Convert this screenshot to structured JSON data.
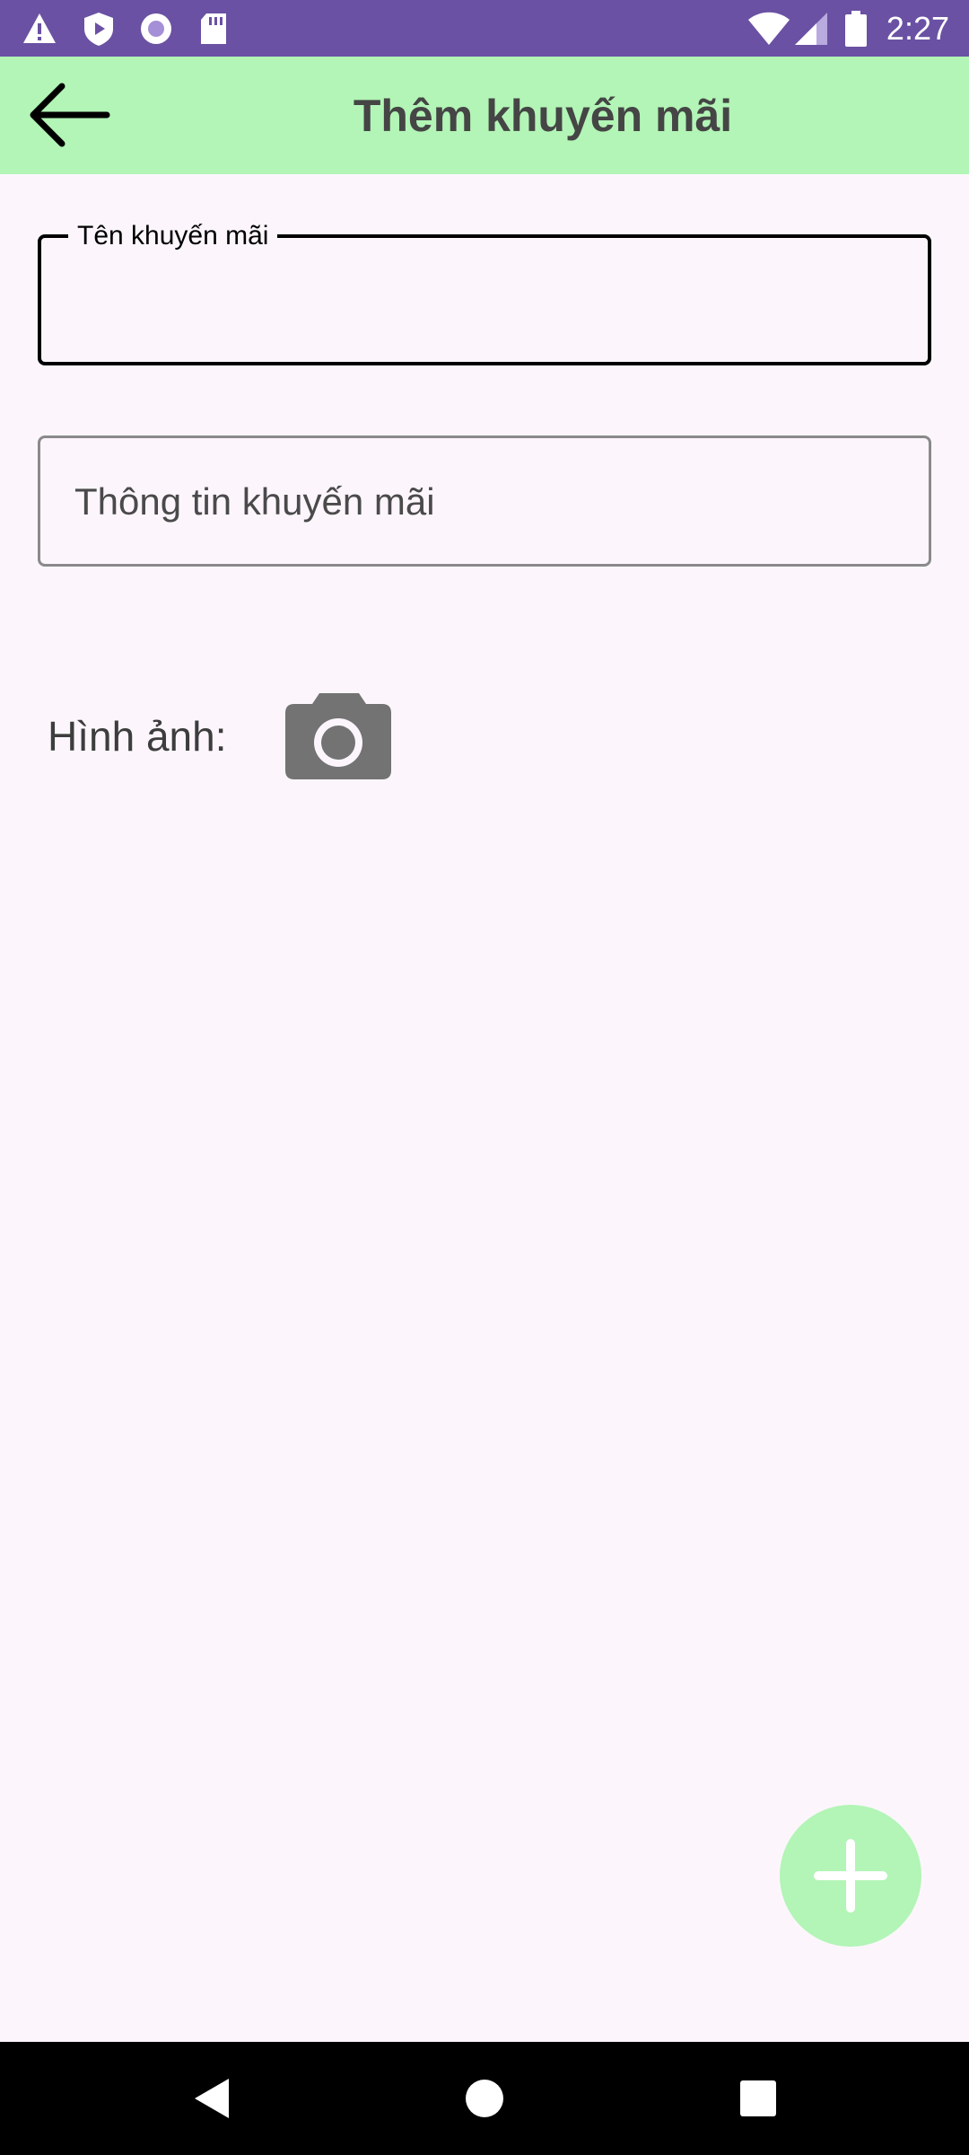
{
  "status_bar": {
    "time": "2:27",
    "left_icons": [
      "warning-icon",
      "shield-play-icon",
      "record-icon",
      "sd-card-icon"
    ],
    "right_icons": [
      "wifi-icon",
      "signal-icon",
      "battery-icon"
    ],
    "background": "#6a51a3"
  },
  "app_bar": {
    "title": "Thêm khuyến mãi",
    "background": "#b2f5b6",
    "back_icon": "arrow-back-icon"
  },
  "form": {
    "name_field": {
      "label": "Tên khuyến mãi",
      "value": ""
    },
    "info_field": {
      "placeholder": "Thông tin khuyến mãi",
      "value": ""
    },
    "image_label": "Hình ảnh:",
    "camera_icon": "camera-icon"
  },
  "fab": {
    "icon": "plus-icon",
    "color": "#b2f5b6"
  },
  "nav_bar": {
    "buttons": [
      "back-triangle-icon",
      "home-circle-icon",
      "recents-square-icon"
    ]
  }
}
